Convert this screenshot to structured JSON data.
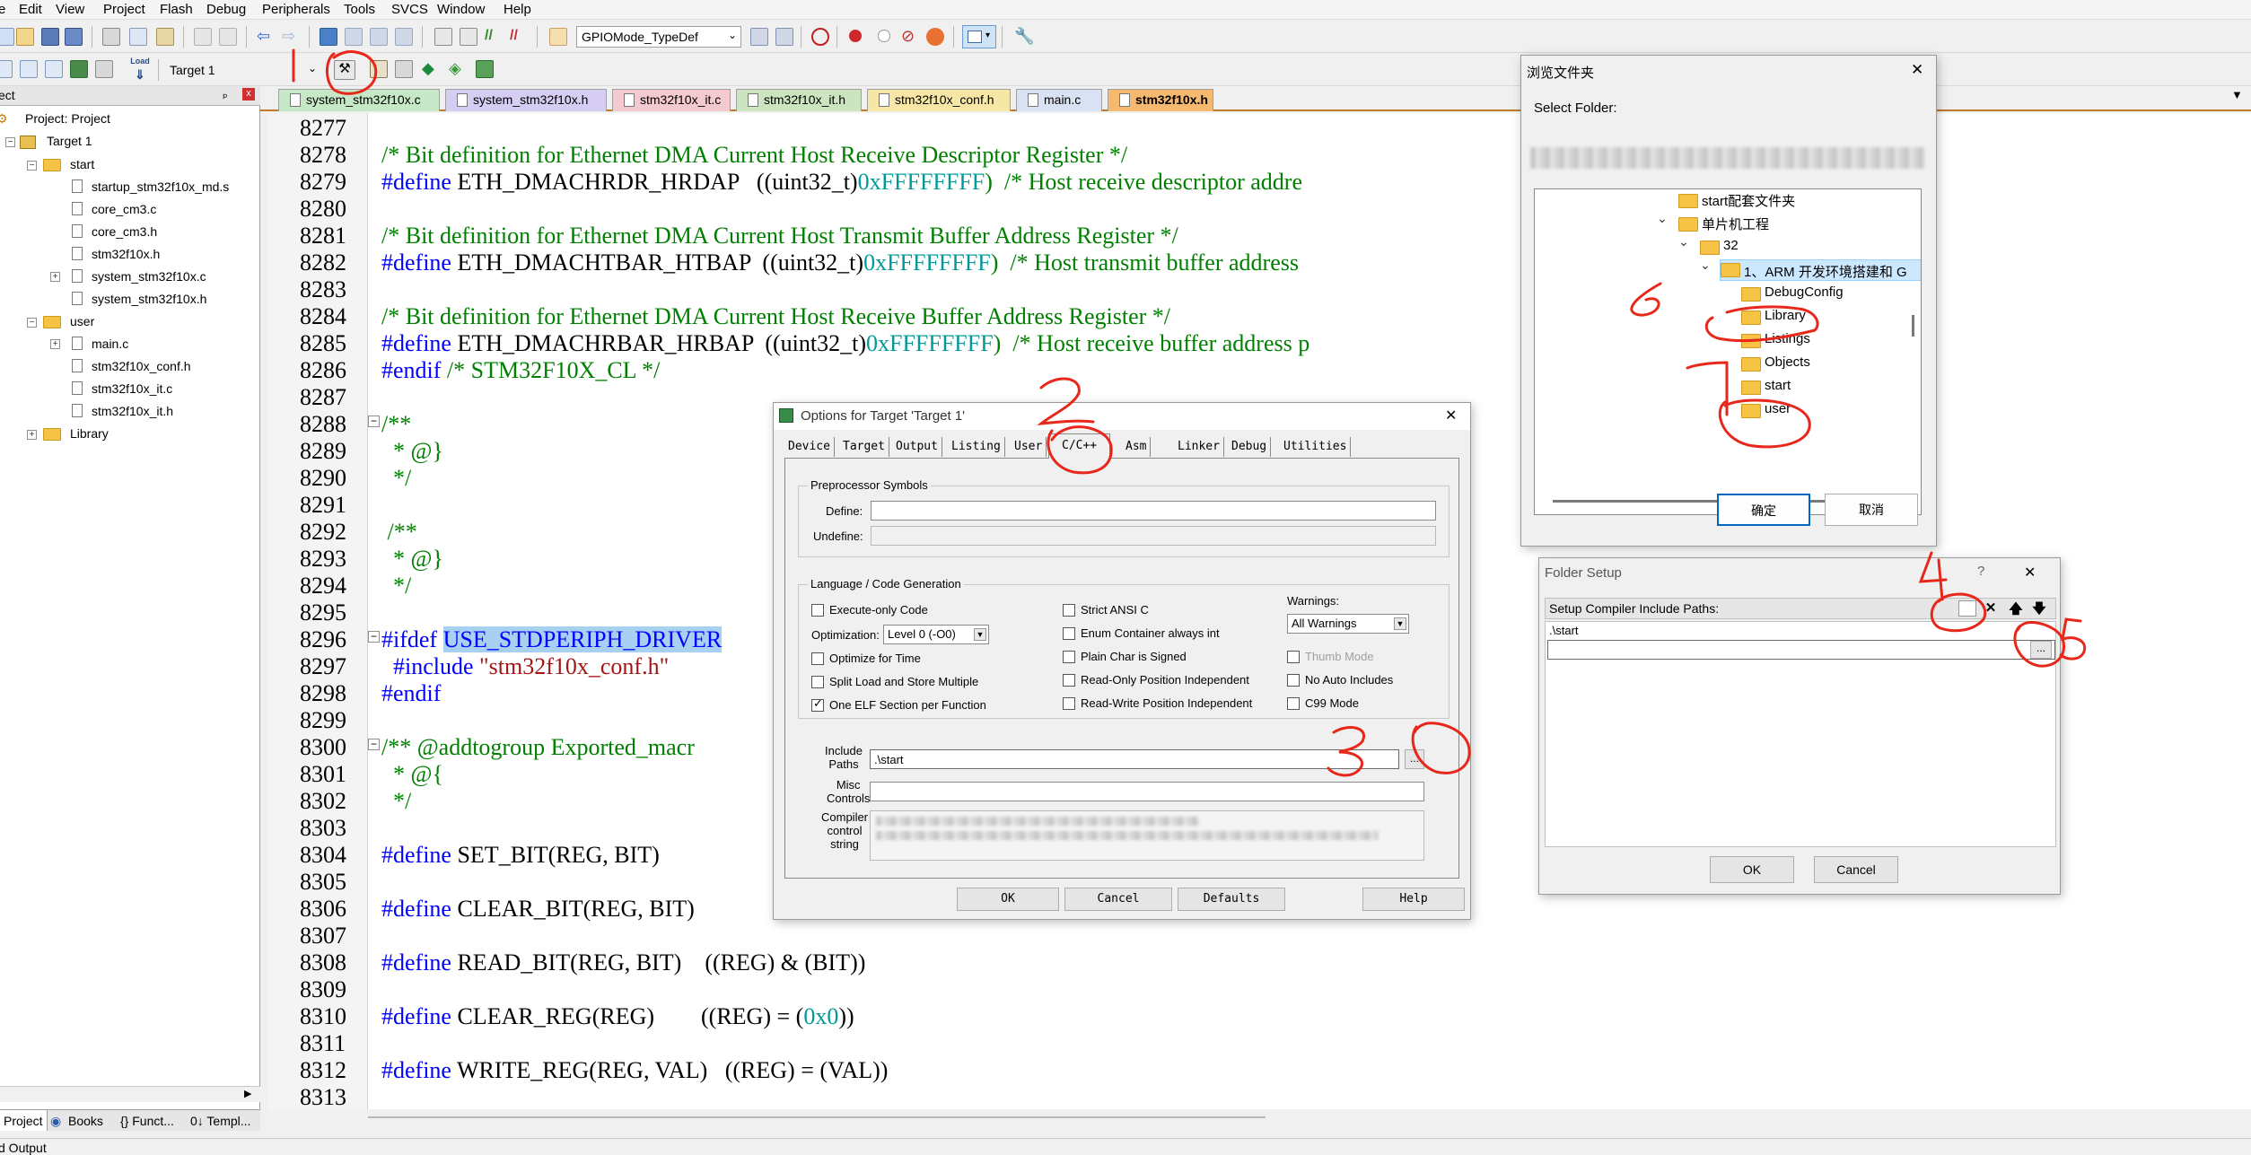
{
  "menubar": {
    "items": [
      "e",
      "Edit",
      "View",
      "Project",
      "Flash",
      "Debug",
      "Peripherals",
      "Tools",
      "SVCS",
      "Window",
      "Help"
    ]
  },
  "toolbar": {
    "define_dropdown": "GPIOMode_TypeDef",
    "target_dropdown": "Target 1",
    "load_label": "Load"
  },
  "project_panel": {
    "header": "ect",
    "pin": "ₚ",
    "close": "x",
    "root": "Project: Project",
    "target": "Target 1",
    "groups": [
      {
        "name": "start",
        "files": [
          "startup_stm32f10x_md.s",
          "core_cm3.c",
          "core_cm3.h",
          "stm32f10x.h",
          "system_stm32f10x.c",
          "system_stm32f10x.h"
        ]
      },
      {
        "name": "user",
        "files": [
          "main.c",
          "stm32f10x_conf.h",
          "stm32f10x_it.c",
          "stm32f10x_it.h"
        ]
      },
      {
        "name": "Library",
        "files": []
      }
    ],
    "bottom_tabs": [
      "Project",
      "Books",
      "{} Funct...",
      "0↓ Templ..."
    ]
  },
  "status_bar": {
    "text": "d Output"
  },
  "file_tabs": [
    {
      "label": "system_stm32f10x.c",
      "color": "#c6e8c6"
    },
    {
      "label": "system_stm32f10x.h",
      "color": "#d6cdf2"
    },
    {
      "label": "stm32f10x_it.c",
      "color": "#f4c9cf"
    },
    {
      "label": "stm32f10x_it.h",
      "color": "#cde4c1"
    },
    {
      "label": "stm32f10x_conf.h",
      "color": "#f6e7a7"
    },
    {
      "label": "main.c",
      "color": "#d9e2f2"
    },
    {
      "label": "stm32f10x.h",
      "color": "#f5b970"
    }
  ],
  "editor": {
    "line_numbers": [
      "8277",
      "8278",
      "8279",
      "8280",
      "8281",
      "8282",
      "8283",
      "8284",
      "8285",
      "8286",
      "8287",
      "8288",
      "8289",
      "8290",
      "8291",
      "8292",
      "8293",
      "8294",
      "8295",
      "8296",
      "8297",
      "8298",
      "8299",
      "8300",
      "8301",
      "8302",
      "8303",
      "8304",
      "8305",
      "8306",
      "8307",
      "8308",
      "8309",
      "8310",
      "8311",
      "8312",
      "8313"
    ],
    "code": {
      "l8278": "/* Bit definition for Ethernet DMA Current Host Receive Descriptor Register */",
      "l8279_a": "#define",
      "l8279_b": " ETH_DMACHRDR_HRDAP   ((uint32_t)",
      "l8279_c": "0xFFFFFFFF",
      "l8279_d": ")  /* Host receive descriptor addre",
      "l8281": "/* Bit definition for Ethernet DMA Current Host Transmit Buffer Address Register */",
      "l8282_a": "#define",
      "l8282_b": " ETH_DMACHTBAR_HTBAP  ((uint32_t)",
      "l8282_c": "0xFFFFFFFF",
      "l8282_d": ")  /* Host transmit buffer address",
      "l8284": "/* Bit definition for Ethernet DMA Current Host Receive Buffer Address Register */",
      "l8285_a": "#define",
      "l8285_b": " ETH_DMACHRBAR_HRBAP  ((uint32_t)",
      "l8285_c": "0xFFFFFFFF",
      "l8285_d": ")  /* Host receive buffer address p",
      "l8286_a": "#endif",
      "l8286_b": " /* STM32F10X_CL */",
      "l8288": "/**",
      "l8289": "  * @}",
      "l8290": "  */",
      "l8292": " /**",
      "l8293": "  * @}",
      "l8294": "  */",
      "l8296_a": "#ifdef",
      "l8296_b": "USE_STDPERIPH_DRIVER",
      "l8297_a": "  #include",
      "l8297_b": " \"stm32f10x_conf.h\"",
      "l8298": "#endif",
      "l8300_a": "/** @addtogroup Exported_macr",
      "l8301": "  * @{",
      "l8302": "  */",
      "l8304_a": "#define",
      "l8304_b": " SET_BIT(REG, BIT)",
      "l8306_a": "#define",
      "l8306_b": " CLEAR_BIT(REG, BIT)",
      "l8308_a": "#define",
      "l8308_b": " READ_BIT(REG, BIT)    ((REG) & (BIT))",
      "l8310_a": "#define",
      "l8310_b": " CLEAR_REG(REG)        ((REG) = (",
      "l8310_c": "0x0",
      "l8310_d": "))",
      "l8312_a": "#define",
      "l8312_b": " WRITE_REG(REG, VAL)   ((REG) = (VAL))"
    }
  },
  "options_dialog": {
    "title": "Options for Target 'Target 1'",
    "close": "✕",
    "tabs": [
      "Device",
      "Target",
      "Output",
      "Listing",
      "User",
      "C/C++",
      "Asm",
      "Linker",
      "Debug",
      "Utilities"
    ],
    "preprocessor": {
      "legend": "Preprocessor Symbols",
      "define_label": "Define:",
      "define_value": "",
      "undefine_label": "Undefine:",
      "undefine_value": ""
    },
    "language": {
      "legend": "Language / Code Generation",
      "col1": [
        {
          "label": "Execute-only Code",
          "checked": false
        }
      ],
      "optimization_label": "Optimization:",
      "optimization_value": "Level 0 (-O0)",
      "col1b": [
        {
          "label": "Optimize for Time",
          "checked": false
        },
        {
          "label": "Split Load and Store Multiple",
          "checked": false
        },
        {
          "label": "One ELF Section per Function",
          "checked": true
        }
      ],
      "col2": [
        {
          "label": "Strict ANSI C",
          "checked": false
        },
        {
          "label": "Enum Container always int",
          "checked": false
        },
        {
          "label": "Plain Char is Signed",
          "checked": false
        },
        {
          "label": "Read-Only Position Independent",
          "checked": false
        },
        {
          "label": "Read-Write Position Independent",
          "checked": false
        }
      ],
      "warnings_label": "Warnings:",
      "warnings_value": "All Warnings",
      "col3": [
        {
          "label": "Thumb Mode",
          "checked": false,
          "disabled": true
        },
        {
          "label": "No Auto Includes",
          "checked": false
        },
        {
          "label": "C99 Mode",
          "checked": false
        }
      ]
    },
    "include_label": "Include\nPaths",
    "include_value": ".\\start",
    "browse": "...",
    "misc_label": "Misc\nControls",
    "misc_value": "",
    "compiler_label": "Compiler\ncontrol\nstring",
    "buttons": [
      "OK",
      "Cancel",
      "Defaults",
      "Help"
    ]
  },
  "browse_dialog": {
    "title": "浏览文件夹",
    "close": "✕",
    "prompt": "Select Folder:",
    "tree": [
      {
        "label": "start配套文件夹",
        "chev": ""
      },
      {
        "label": "单片机工程",
        "chev": "⌄"
      },
      {
        "label": "32",
        "chev": "⌄"
      },
      {
        "label": "1、ARM 开发环境搭建和 G",
        "chev": "⌄",
        "selected": true
      },
      {
        "label": "DebugConfig",
        "chev": ""
      },
      {
        "label": "Library",
        "chev": ""
      },
      {
        "label": "Listings",
        "chev": ""
      },
      {
        "label": "Objects",
        "chev": ""
      },
      {
        "label": "start",
        "chev": ""
      },
      {
        "label": "user",
        "chev": ""
      }
    ],
    "ok": "确定",
    "cancel": "取消"
  },
  "folder_setup": {
    "title": "Folder Setup",
    "help": "?",
    "close": "✕",
    "paths_label": "Setup Compiler Include Paths:",
    "paths": [
      ".\\start",
      ""
    ],
    "browse": "...",
    "ok": "OK",
    "cancel": "Cancel"
  },
  "colors": {
    "annotation": "#e8271b",
    "selection": "#cce8ff",
    "highlight": "#a8d0f0",
    "active_tab": "#f5b970"
  }
}
